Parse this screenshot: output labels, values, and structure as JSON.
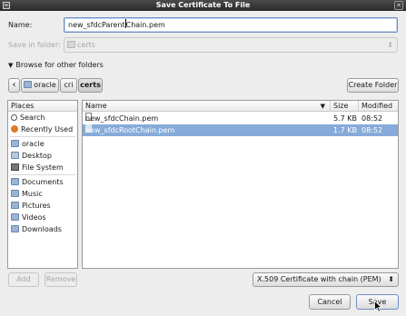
{
  "window": {
    "title": "Save Certificate To File"
  },
  "name_field": {
    "label": "Name:",
    "value_before_cursor": "new_sfdcParent",
    "value_after_cursor": "Chain.pem"
  },
  "save_in": {
    "label": "Save in folder:",
    "value": "certs"
  },
  "browse": {
    "label": "Browse for other folders"
  },
  "path_bar": {
    "back_glyph": "‹",
    "segments": [
      "oracle",
      "cri",
      "certs"
    ],
    "create_folder_label": "Create Folder"
  },
  "places": {
    "header": "Places",
    "items": [
      {
        "label": "Search",
        "icon": "search-icon"
      },
      {
        "label": "Recently Used",
        "icon": "recent-icon"
      },
      {
        "label": "oracle",
        "icon": "home-folder-icon"
      },
      {
        "label": "Desktop",
        "icon": "desktop-icon"
      },
      {
        "label": "File System",
        "icon": "drive-icon"
      },
      {
        "label": "Documents",
        "icon": "folder-icon"
      },
      {
        "label": "Music",
        "icon": "folder-icon"
      },
      {
        "label": "Pictures",
        "icon": "folder-icon"
      },
      {
        "label": "Videos",
        "icon": "folder-icon"
      },
      {
        "label": "Downloads",
        "icon": "folder-icon"
      }
    ]
  },
  "files": {
    "columns": {
      "name": "Name",
      "sort_glyph": "▼",
      "size": "Size",
      "modified": "Modified"
    },
    "rows": [
      {
        "name": "new_sfdcChain.pem",
        "size": "5.7 KB",
        "modified": "08:52",
        "selected": false
      },
      {
        "name": "new_sfdcRootChain.pem",
        "size": "1.7 KB",
        "modified": "08:52",
        "selected": true
      }
    ]
  },
  "buttons": {
    "add": "Add",
    "remove": "Remove",
    "cancel": "Cancel",
    "save": "Save"
  },
  "filter": {
    "value": "X.509 Certificate with chain (PEM)"
  },
  "colors": {
    "selection": "#86abd9",
    "titlebar": "#333333"
  }
}
